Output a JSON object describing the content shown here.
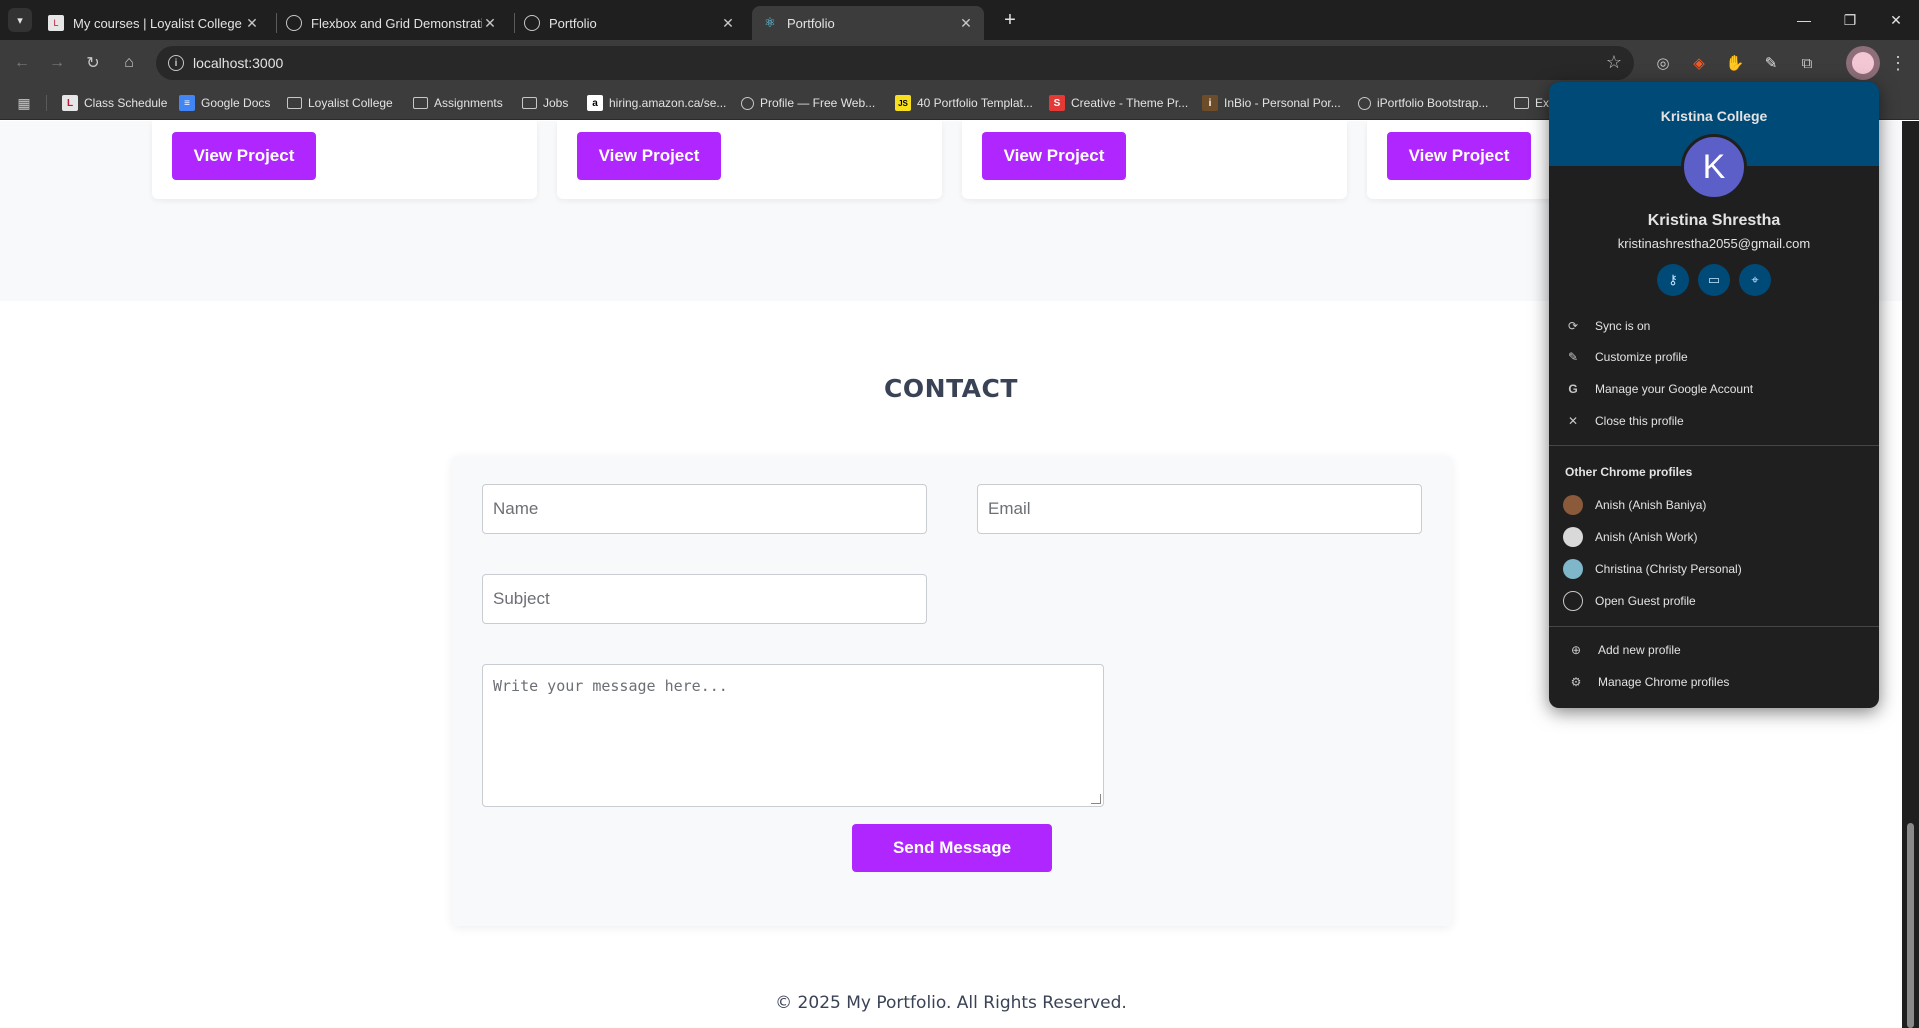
{
  "browser": {
    "tabs": [
      {
        "title": "My courses | Loyalist College In",
        "active": false
      },
      {
        "title": "Flexbox and Grid Demonstratio",
        "active": false
      },
      {
        "title": "Portfolio",
        "active": false
      },
      {
        "title": "Portfolio",
        "active": true
      }
    ],
    "url": "localhost:3000",
    "bookmarks": [
      "Class Schedule",
      "Google Docs",
      "Loyalist College",
      "Assignments",
      "Jobs",
      "hiring.amazon.ca/se...",
      "Profile — Free Web...",
      "40 Portfolio Templat...",
      "Creative - Theme Pr...",
      "InBio - Personal Por...",
      "iPortfolio Bootstrap...",
      "Ex"
    ],
    "accent": "#b026ff"
  },
  "page": {
    "projects": {
      "button_label": "View Project",
      "button_labels": [
        "View Project",
        "View Project",
        "View Project",
        "View Project"
      ]
    },
    "contact": {
      "title": "CONTACT",
      "name_placeholder": "Name",
      "email_placeholder": "Email",
      "subject_placeholder": "Subject",
      "message_placeholder": "Write your message here...",
      "send_label": "Send Message"
    },
    "footer": {
      "text": "© 2025 My Portfolio. All Rights Reserved."
    }
  },
  "profile_popup": {
    "org": "Kristina College",
    "avatar_letter": "K",
    "name": "Kristina Shrestha",
    "email": "kristinashrestha2055@gmail.com",
    "quick_icons": [
      "key-icon",
      "card-icon",
      "location-icon"
    ],
    "menu": [
      {
        "icon": "sync-icon",
        "label": "Sync is on"
      },
      {
        "icon": "pencil-icon",
        "label": "Customize profile"
      },
      {
        "icon": "google-icon",
        "label": "Manage your Google Account"
      },
      {
        "icon": "close-icon",
        "label": "Close this profile"
      }
    ],
    "other_profiles_heading": "Other Chrome profiles",
    "other_profiles": [
      {
        "label": "Anish (Anish Baniya)",
        "color": "#8a5a3a"
      },
      {
        "label": "Anish (Anish Work)",
        "color": "#d9d9d9"
      },
      {
        "label": "Christina (Christy Personal)",
        "color": "#7fb6c9"
      },
      {
        "label": "Open Guest profile",
        "color": "#1f1f1f"
      }
    ],
    "footer_actions": [
      {
        "icon": "add-person-icon",
        "label": "Add new profile"
      },
      {
        "icon": "manage-people-icon",
        "label": "Manage Chrome profiles"
      }
    ]
  }
}
